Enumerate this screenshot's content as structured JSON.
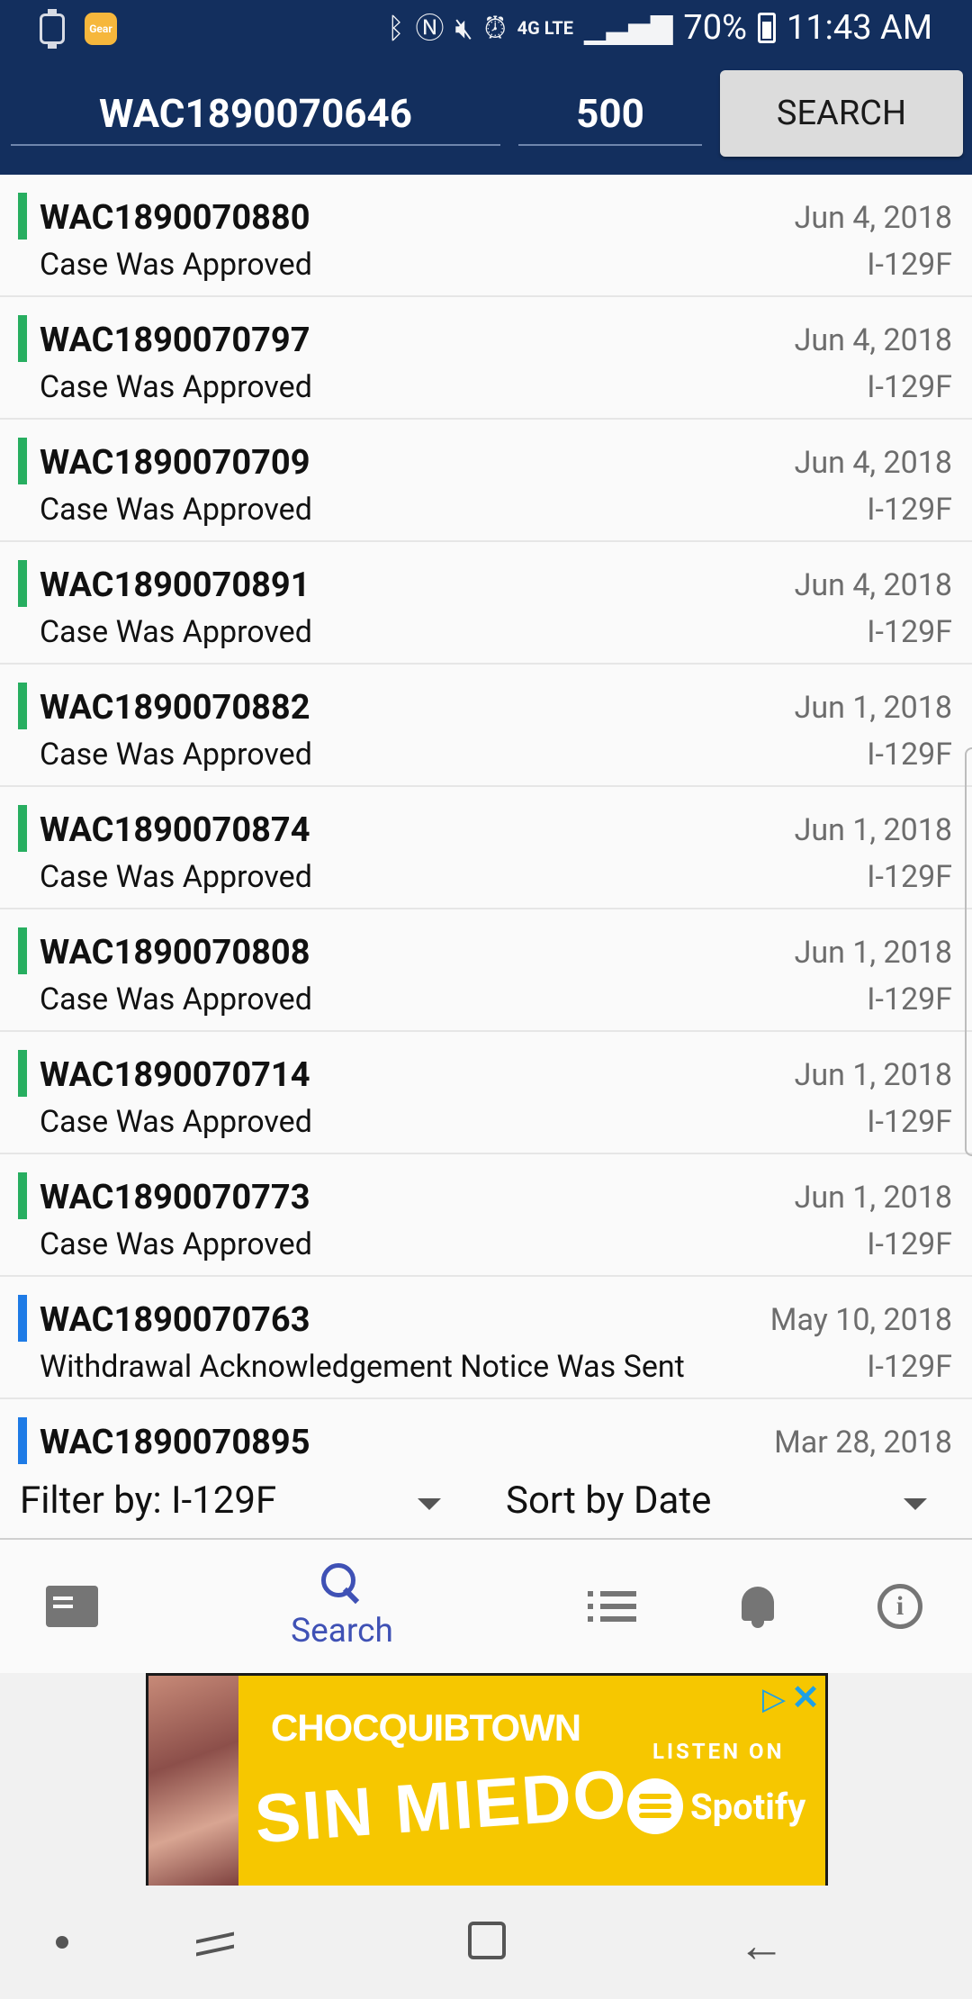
{
  "status_bar": {
    "gear_app_label": "Gear",
    "battery": "70%",
    "time": "11:43 AM",
    "network": "4G LTE"
  },
  "search": {
    "case_number": "WAC1890070646",
    "count": "500",
    "button_label": "SEARCH"
  },
  "cases": [
    {
      "case": "WAC1890070880",
      "status": "Case Was Approved",
      "date": "Jun 4, 2018",
      "form": "I-129F",
      "color": "#27ae60"
    },
    {
      "case": "WAC1890070797",
      "status": "Case Was Approved",
      "date": "Jun 4, 2018",
      "form": "I-129F",
      "color": "#27ae60"
    },
    {
      "case": "WAC1890070709",
      "status": "Case Was Approved",
      "date": "Jun 4, 2018",
      "form": "I-129F",
      "color": "#27ae60"
    },
    {
      "case": "WAC1890070891",
      "status": "Case Was Approved",
      "date": "Jun 4, 2018",
      "form": "I-129F",
      "color": "#27ae60"
    },
    {
      "case": "WAC1890070882",
      "status": "Case Was Approved",
      "date": "Jun 1, 2018",
      "form": "I-129F",
      "color": "#27ae60"
    },
    {
      "case": "WAC1890070874",
      "status": "Case Was Approved",
      "date": "Jun 1, 2018",
      "form": "I-129F",
      "color": "#27ae60"
    },
    {
      "case": "WAC1890070808",
      "status": "Case Was Approved",
      "date": "Jun 1, 2018",
      "form": "I-129F",
      "color": "#27ae60"
    },
    {
      "case": "WAC1890070714",
      "status": "Case Was Approved",
      "date": "Jun 1, 2018",
      "form": "I-129F",
      "color": "#27ae60"
    },
    {
      "case": "WAC1890070773",
      "status": "Case Was Approved",
      "date": "Jun 1, 2018",
      "form": "I-129F",
      "color": "#27ae60"
    },
    {
      "case": "WAC1890070763",
      "status": "Withdrawal Acknowledgement Notice Was Sent",
      "date": "May 10, 2018",
      "form": "I-129F",
      "color": "#1e7be6"
    },
    {
      "case": "WAC1890070895",
      "status": "",
      "date": "Mar 28, 2018",
      "form": "",
      "color": "#1e7be6"
    }
  ],
  "filter": {
    "filter_label": "Filter by: I-129F",
    "sort_label": "Sort by Date"
  },
  "bottom_nav": {
    "search_label": "Search",
    "active": "search",
    "active_color": "#3f51b5"
  },
  "ad": {
    "artist": "CHOCQUIBTOWN",
    "song": "SIN MIEDO",
    "listen_on": "LISTEN ON",
    "service": "Spotify",
    "background": "#f6c700"
  }
}
